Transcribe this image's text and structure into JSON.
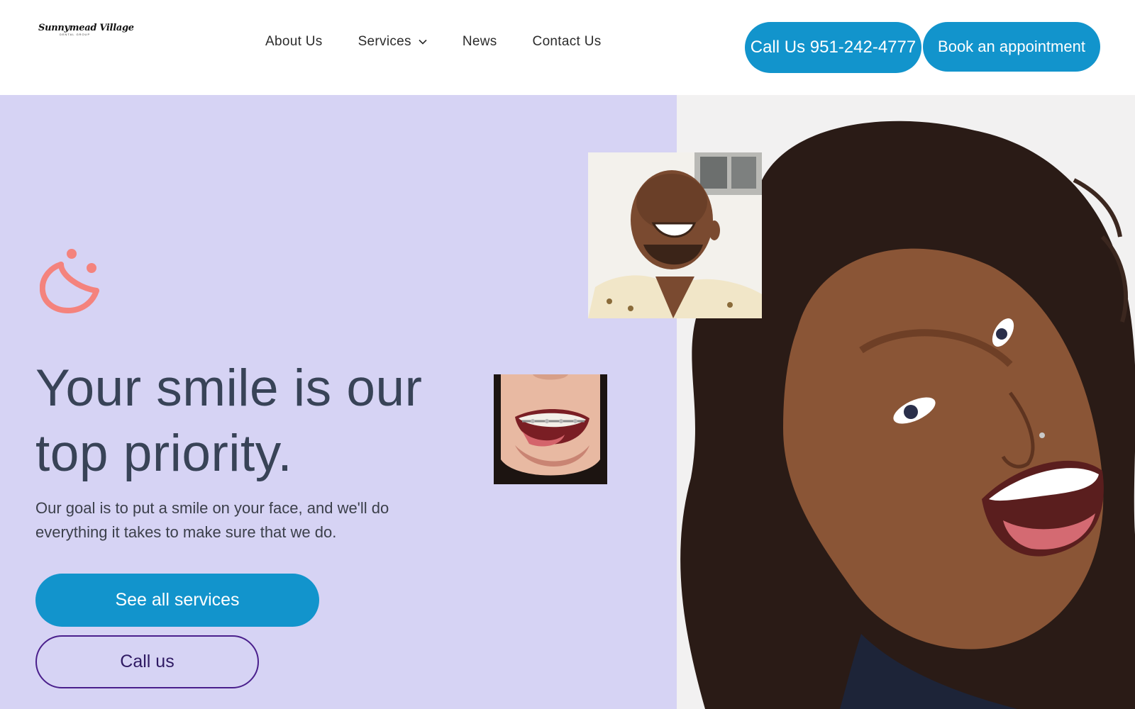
{
  "header": {
    "logo": {
      "name": "Sunnymead Village",
      "sub": "DENTAL GROUP",
      "icon": "tooth-icon"
    },
    "nav": [
      {
        "label": "About Us"
      },
      {
        "label": "Services",
        "icon": "chevron-down-icon"
      },
      {
        "label": "News"
      },
      {
        "label": "Contact Us"
      }
    ],
    "call_button": "Call Us 951-242-4777",
    "book_button": "Book an appointment"
  },
  "hero": {
    "icon": "smile-icon",
    "headline": "Your smile is our top priority.",
    "subtext": "Our goal is to put a smile on your face, and we'll do everything it takes to make sure that we do.",
    "primary_button": "See all services",
    "secondary_button": "Call us"
  },
  "colors": {
    "accent": "#1294cc",
    "hero_bg": "#d6d3f4",
    "smile_icon": "#f4837d",
    "headline": "#384357",
    "outline_button": "#4a1f8c"
  }
}
